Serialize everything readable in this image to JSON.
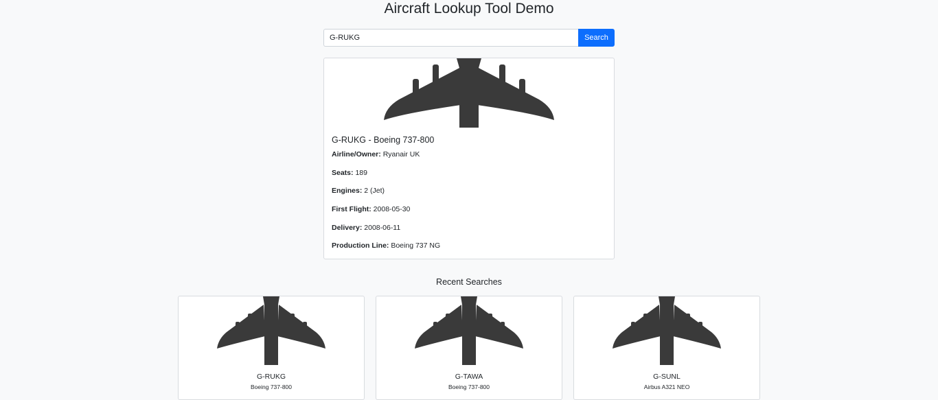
{
  "page": {
    "title": "Aircraft Lookup Tool Demo"
  },
  "search": {
    "value": "G-RUKG",
    "button_label": "Search"
  },
  "result": {
    "heading": "G-RUKG - Boeing 737-800",
    "image_icon": "airplane-silhouette-icon",
    "fields": [
      {
        "label": "Airline/Owner:",
        "value": "Ryanair UK"
      },
      {
        "label": "Seats:",
        "value": "189"
      },
      {
        "label": "Engines:",
        "value": "2 (Jet)"
      },
      {
        "label": "First Flight:",
        "value": "2008-05-30"
      },
      {
        "label": "Delivery:",
        "value": "2008-06-11"
      },
      {
        "label": "Production Line:",
        "value": "Boeing 737 NG"
      }
    ]
  },
  "recent": {
    "title": "Recent Searches",
    "items": [
      {
        "registration": "G-RUKG",
        "type": "Boeing 737-800"
      },
      {
        "registration": "G-TAWA",
        "type": "Boeing 737-800"
      },
      {
        "registration": "G-SUNL",
        "type": "Airbus A321 NEO"
      }
    ]
  },
  "colors": {
    "accent": "#0d6efd",
    "silhouette": "#3a3a3a",
    "background": "#f8f9fa"
  }
}
